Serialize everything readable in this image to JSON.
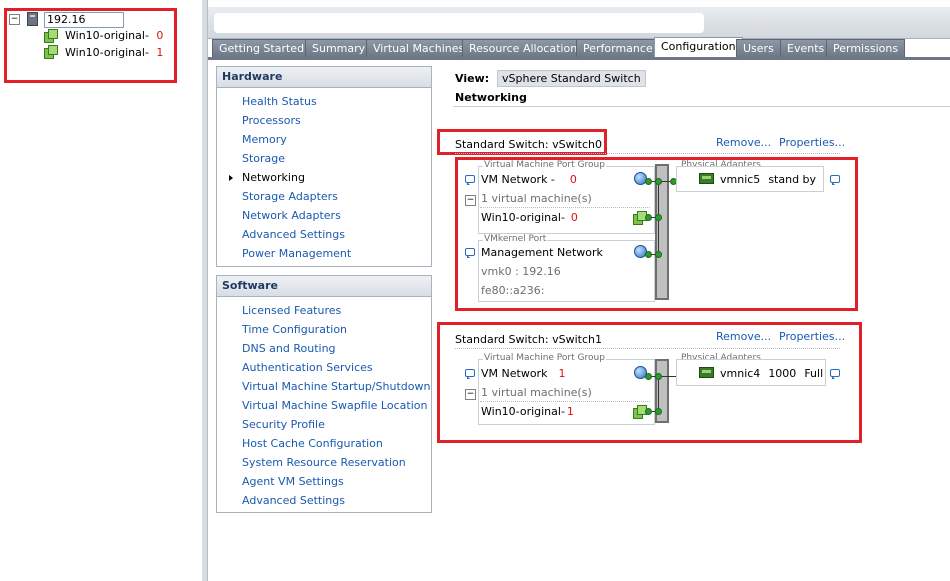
{
  "inventory": {
    "host": "192.16",
    "vms": [
      {
        "name": "Win10-original-",
        "index": "0"
      },
      {
        "name": "Win10-original-",
        "index": "1"
      }
    ]
  },
  "tabs": [
    "Getting Started",
    "Summary",
    "Virtual Machines",
    "Resource Allocation",
    "Performance",
    "Configuration",
    "Users",
    "Events",
    "Permissions"
  ],
  "hardware": {
    "title": "Hardware",
    "items": [
      "Health Status",
      "Processors",
      "Memory",
      "Storage",
      "Networking",
      "Storage Adapters",
      "Network Adapters",
      "Advanced Settings",
      "Power Management"
    ]
  },
  "software": {
    "title": "Software",
    "items": [
      "Licensed Features",
      "Time Configuration",
      "DNS and Routing",
      "Authentication Services",
      "Virtual Machine Startup/Shutdown",
      "Virtual Machine Swapfile Location",
      "Security Profile",
      "Host Cache Configuration",
      "System Resource Reservation",
      "Agent VM Settings",
      "Advanced Settings"
    ]
  },
  "view": {
    "label": "View:",
    "value": "vSphere Standard Switch"
  },
  "section_title": "Networking",
  "switches": [
    {
      "title": "Standard Switch: vSwitch0",
      "remove": "Remove...",
      "properties": "Properties...",
      "vm_group_label": "Virtual Machine Port Group",
      "vm_network": "VM Network -",
      "vm_network_index": "0",
      "vm_count": "1 virtual machine(s)",
      "vm_name": "Win10-original-",
      "vm_index": "0",
      "vmk_label": "VMkernel Port",
      "vmk_name": "Management Network",
      "vmk_ip4": "vmk0 : 192.16",
      "vmk_ip6": "fe80::a236:",
      "pa_label": "Physical Adapters",
      "nic_name": "vmnic5",
      "nic_speed": "stand by",
      "nic_duplex": ""
    },
    {
      "title": "Standard Switch: vSwitch1",
      "remove": "Remove...",
      "properties": "Properties...",
      "vm_group_label": "Virtual Machine Port Group",
      "vm_network": "VM Network",
      "vm_network_index": "1",
      "vm_count": "1 virtual machine(s)",
      "vm_name": "Win10-original-",
      "vm_index": "1",
      "pa_label": "Physical Adapters",
      "nic_name": "vmnic4",
      "nic_speed": "1000",
      "nic_duplex": "Full"
    }
  ],
  "colors": {
    "annotation": "#e2202a",
    "link": "#1a5ab0",
    "index": "#dd1111"
  }
}
